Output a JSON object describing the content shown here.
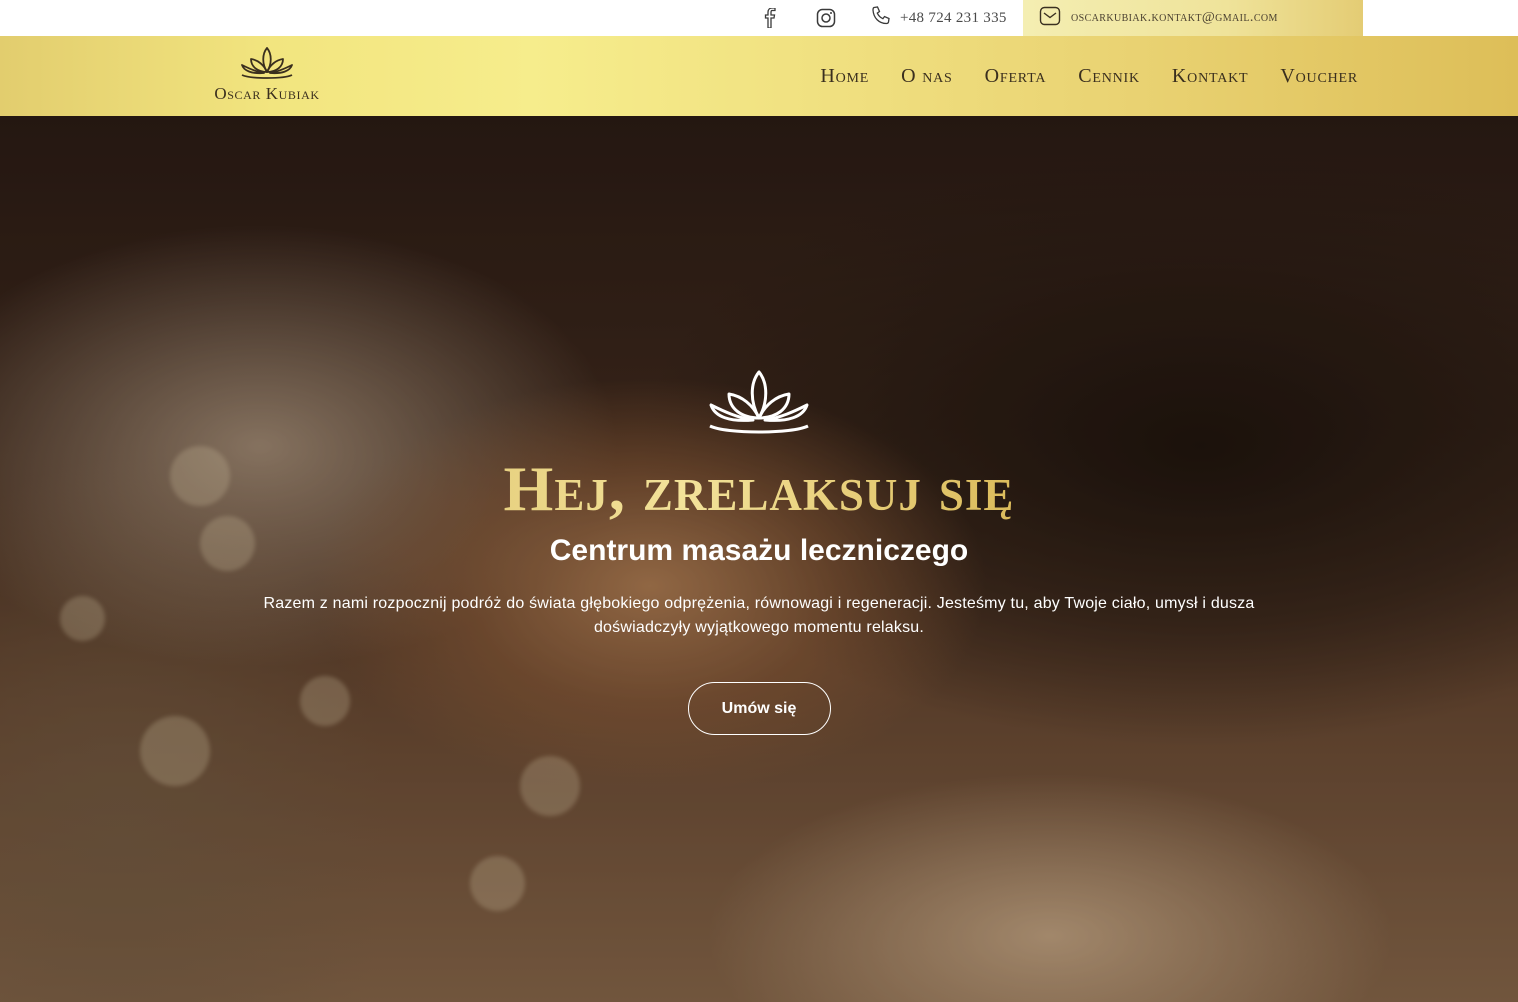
{
  "topbar": {
    "facebook_icon": "facebook-icon",
    "instagram_icon": "instagram-icon",
    "phone_icon": "phone-icon",
    "phone": "+48 724 231 335",
    "mail_icon": "mail-icon",
    "email": "OSCARKUBIAK.KONTAKT@GMAIL.COM"
  },
  "logo": {
    "icon": "lotus-icon",
    "name": "Oscar Kubiak"
  },
  "nav": {
    "items": [
      {
        "label": "Home"
      },
      {
        "label": "O nas"
      },
      {
        "label": "Oferta"
      },
      {
        "label": "Cennik"
      },
      {
        "label": "Kontakt"
      },
      {
        "label": "Voucher"
      }
    ]
  },
  "hero": {
    "icon": "lotus-icon",
    "title": "Hej, zrelaksuj się",
    "subtitle": "Centrum masażu leczniczego",
    "text": "Razem z nami rozpocznij podróż do świata głębokiego odprężenia, równowagi i regeneracji. Jesteśmy tu, aby Twoje ciało, umysł i dusza doświadczyły wyjątkowego momentu relaksu.",
    "button": "Umów się"
  },
  "colors": {
    "gold_light": "#f6ed8c",
    "gold_dark": "#ddbe58",
    "text_dark": "#3a2f1e"
  }
}
